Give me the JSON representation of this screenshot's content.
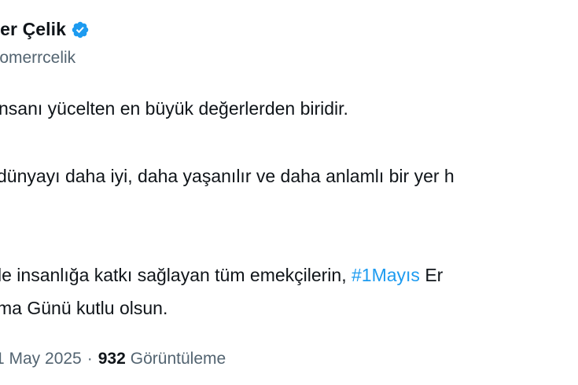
{
  "author": {
    "name": "ner Çelik",
    "handle": "omerrcelik",
    "verified_color": "#1d9bf0"
  },
  "tweet": {
    "line1": "nsanı yücelten en büyük değerlerden biridir.",
    "line2": "dünyayı daha iyi, daha yaşanılır ve daha anlamlı bir yer h",
    "line3_prefix": "le insanlığa katkı sağlayan tüm emekçilerin, ",
    "line3_hashtag": "#1Mayıs",
    "line3_suffix": " Er",
    "line4": "ma Günü kutlu olsun."
  },
  "meta": {
    "date": "1 May 2025",
    "separator": "·",
    "views_count": "932",
    "views_label": "Görüntüleme"
  },
  "colors": {
    "text": "#0f1419",
    "secondary": "#536471",
    "accent": "#1d9bf0"
  }
}
